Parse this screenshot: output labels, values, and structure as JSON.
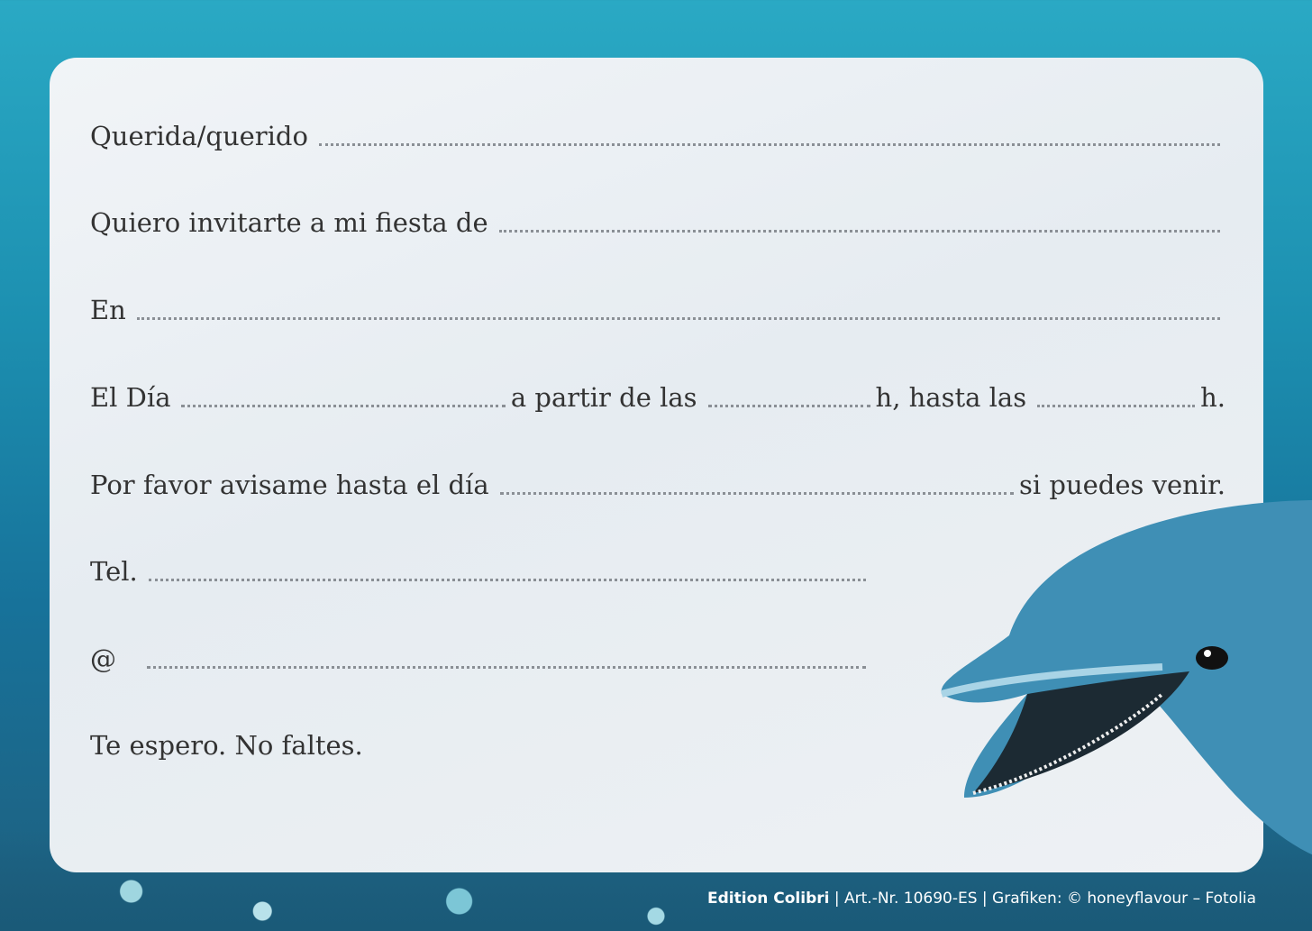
{
  "card": {
    "lines": {
      "dear": "Querida/querido",
      "invite": "Quiero invitarte a mi fiesta de",
      "place": "En",
      "day": "El Día",
      "from": "a partir de las",
      "until": "h, hasta las",
      "h": "h.",
      "rsvp": "Por favor avisame hasta el día",
      "rsvp_end": "si puedes venir.",
      "tel": "Tel.",
      "email": "@",
      "closing": "Te espero. No faltes."
    }
  },
  "footer": {
    "brand": "Edition Colibri",
    "rest": " | Art.-Nr. 10690-ES | Grafiken: © honeyflavour – Fotolia"
  }
}
